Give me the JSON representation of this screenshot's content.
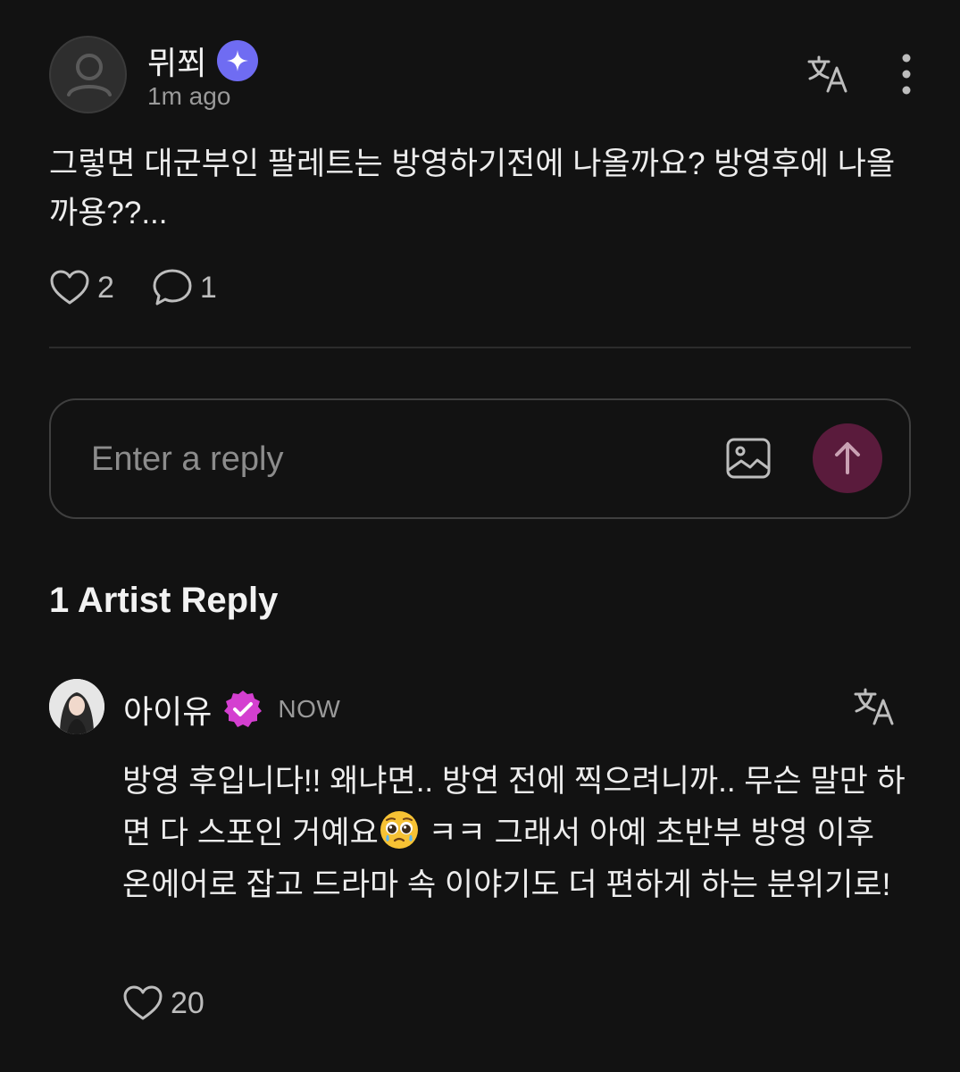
{
  "post": {
    "author": "뮈쬐",
    "time": "1m ago",
    "body": "그렇면 대군부인 팔레트는 방영하기전에 나올까요? 방영후에 나올까용??...",
    "likes": "2",
    "comments": "1"
  },
  "reply_input": {
    "placeholder": "Enter a reply"
  },
  "artist_replies": {
    "title": "1 Artist Reply",
    "items": [
      {
        "author": "아이유",
        "time": "NOW",
        "body_before_emoji": "방영 후입니다!! 왜냐면.. 방연 전에 찍으려니까.. 무슨 말만 하면 다 스포인 거예요",
        "body_after_emoji": " ㅋㅋ 그래서 아예 초반부 방영 이후 온에어로 잡고 드라마 속 이야기도 더 편하게 하는 분위기로!",
        "likes": "20"
      }
    ]
  },
  "colors": {
    "background": "#121212",
    "verified_star_badge": "#6f6cf2",
    "artist_badge": "#d43fd0",
    "send_button": "#5a1b3c"
  },
  "icons": {
    "author_avatar": "default-user-avatar",
    "author_badge": "star-badge-icon",
    "translate": "translate-icon",
    "more": "more-vertical-icon",
    "like": "heart-icon",
    "comment": "comment-bubble-icon",
    "image": "image-icon",
    "send": "arrow-up-icon",
    "artist_badge": "verified-check-icon",
    "emoji": "pleading-face-emoji"
  }
}
